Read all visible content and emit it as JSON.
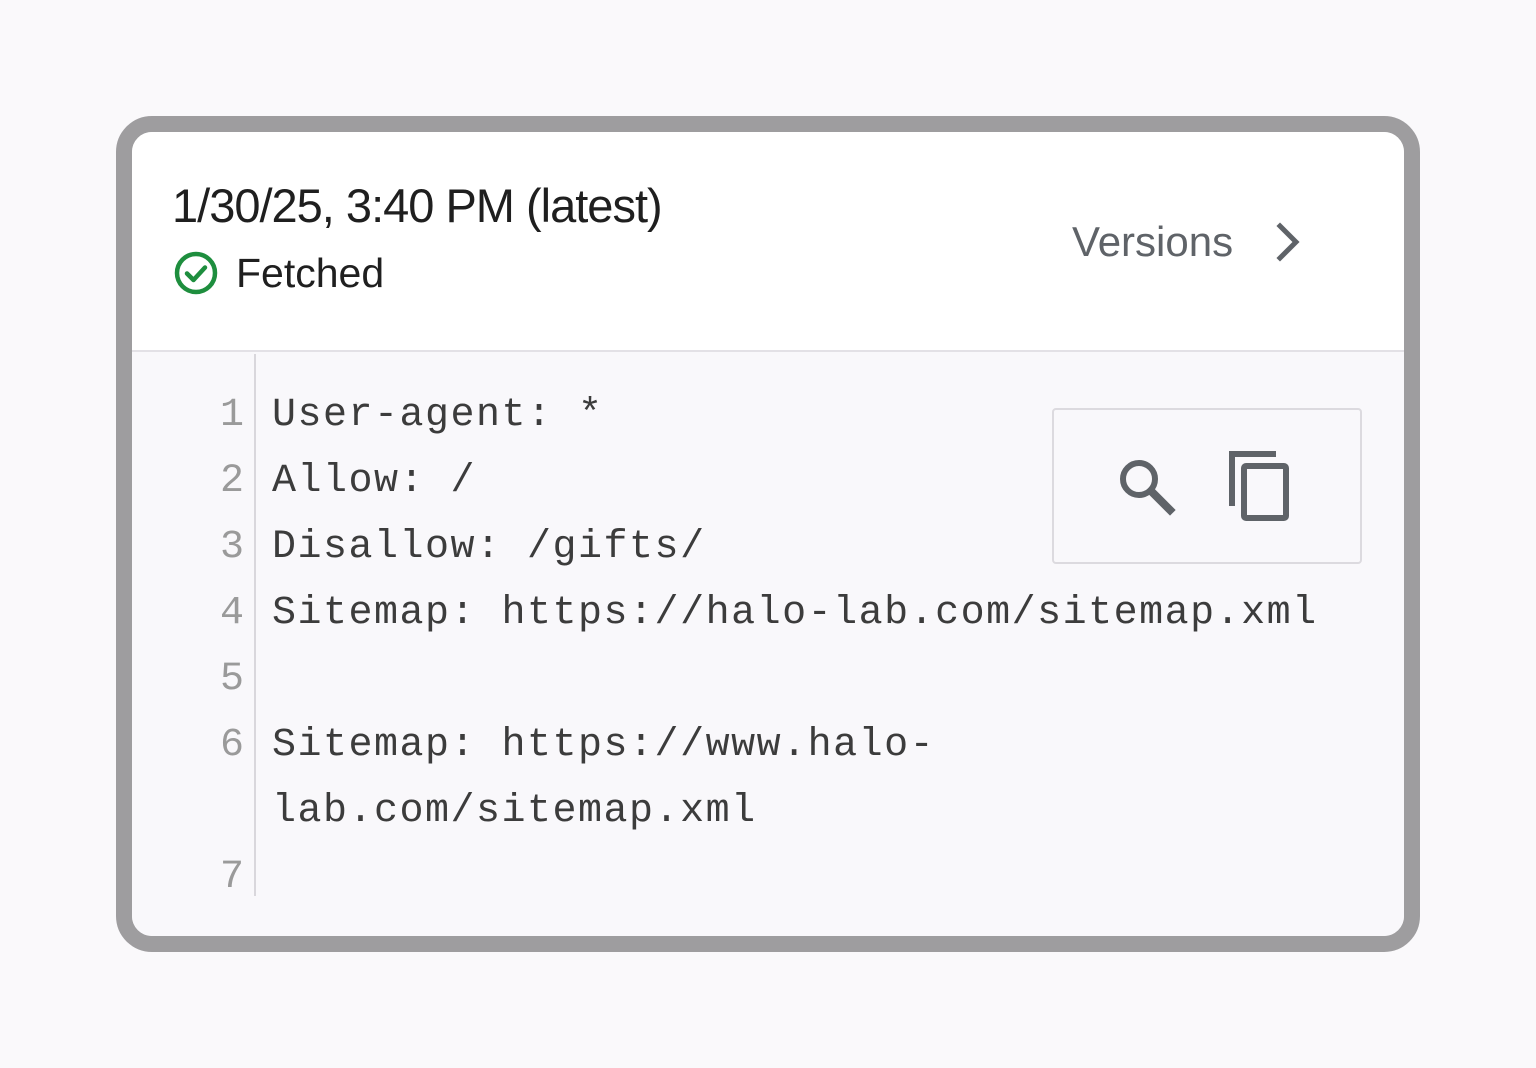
{
  "header": {
    "timestamp": "1/30/25, 3:40 PM (latest)",
    "status_label": "Fetched",
    "status_icon": "check-circle-icon",
    "status_color": "#1e8e3e",
    "versions_label": "Versions",
    "versions_icon": "chevron-right-icon"
  },
  "code": {
    "lines": [
      {
        "number": "1",
        "text": "User-agent: *"
      },
      {
        "number": "2",
        "text": "Allow: /"
      },
      {
        "number": "3",
        "text": "Disallow: /gifts/"
      },
      {
        "number": "4",
        "text": "Sitemap: https://halo-lab.com/sitemap.xml"
      },
      {
        "number": "5",
        "text": ""
      },
      {
        "number": "6",
        "text": "Sitemap: https://www.halo-"
      },
      {
        "number": "",
        "text": "lab.com/sitemap.xml"
      },
      {
        "number": "7",
        "text": ""
      }
    ]
  },
  "toolbox": {
    "search_icon": "search-icon",
    "copy_icon": "copy-icon"
  },
  "colors": {
    "frame": "#9e9d9f",
    "text_primary": "#1f1f1f",
    "text_secondary": "#5f6368",
    "code_background": "#f9f8fb"
  }
}
